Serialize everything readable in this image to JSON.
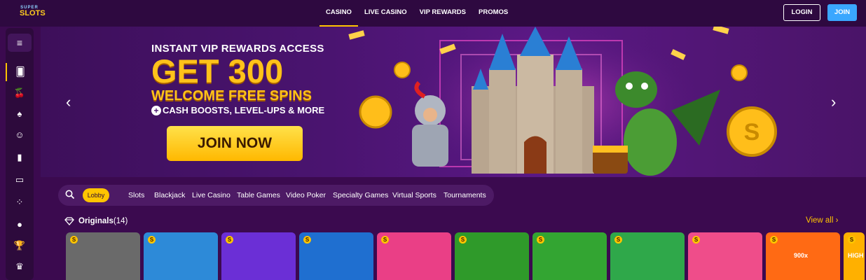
{
  "logo": {
    "line1": "SUPER",
    "line2": "SLOTS"
  },
  "nav": {
    "items": [
      {
        "label": "CASINO",
        "active": true
      },
      {
        "label": "LIVE CASINO",
        "active": false
      },
      {
        "label": "VIP REWARDS",
        "active": false
      },
      {
        "label": "PROMOS",
        "active": false
      }
    ]
  },
  "auth": {
    "login": "LOGIN",
    "join": "JOIN"
  },
  "sidebar": {
    "menu_icon": "≡",
    "icons": [
      "cards-icon",
      "cherries-icon",
      "spade-icon",
      "dealer-icon",
      "playing-cards-icon",
      "laptop-icon",
      "dice-icon",
      "basketball-icon",
      "trophy-icon",
      "crown-icon"
    ]
  },
  "hero": {
    "line1": "INSTANT VIP REWARDS ACCESS",
    "line2": "GET 300",
    "line3": "WELCOME FREE SPINS",
    "line4": "CASH BOOSTS, LEVEL-UPS & MORE",
    "cta": "JOIN NOW",
    "prev": "‹",
    "next": "›"
  },
  "categories": {
    "active": "Lobby",
    "items": [
      "Slots",
      "Blackjack",
      "Live Casino",
      "Table Games",
      "Video Poker",
      "Specialty Games",
      "Virtual Sports",
      "Tournaments"
    ]
  },
  "originals": {
    "title": "Originals",
    "count": "(14)",
    "view_all": "View all",
    "coin_label": "S",
    "tiles": [
      {
        "name": "blackjack",
        "bg": "#6a6a6a"
      },
      {
        "name": "mines",
        "bg": "#2d8ad8"
      },
      {
        "name": "chicken",
        "bg": "#6b2fd6"
      },
      {
        "name": "plinko",
        "bg": "#1f6fd0"
      },
      {
        "name": "dice",
        "bg": "#ea3f86"
      },
      {
        "name": "roulette",
        "bg": "#2f9a2a"
      },
      {
        "name": "keno",
        "bg": "#33a532"
      },
      {
        "name": "hilo",
        "bg": "#2fa84a"
      },
      {
        "name": "video-poker",
        "bg": "#ef4d8a"
      },
      {
        "name": "crash",
        "bg": "#ff6a14",
        "label": "900x"
      },
      {
        "name": "high",
        "bg": "#ffb000",
        "label": "HIGH"
      }
    ]
  },
  "colors": {
    "accent": "#ffc400",
    "join": "#3aa7ff",
    "background": "#3b0a4f"
  }
}
